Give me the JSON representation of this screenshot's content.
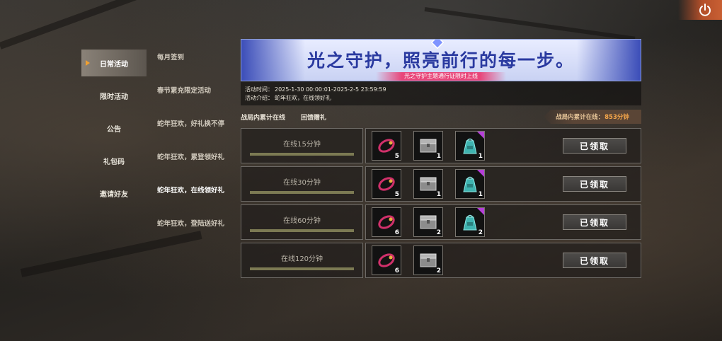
{
  "left_nav": [
    {
      "label": "日常活动",
      "active": true
    },
    {
      "label": "限时活动",
      "active": false
    },
    {
      "label": "公告",
      "active": false
    },
    {
      "label": "礼包码",
      "active": false
    },
    {
      "label": "邀请好友",
      "active": false
    }
  ],
  "sub_list": [
    {
      "label": "每月签到",
      "active": false
    },
    {
      "label": "春节累充限定活动",
      "active": false
    },
    {
      "label": "蛇年狂欢，好礼换不停",
      "active": false
    },
    {
      "label": "蛇年狂欢，累登领好礼",
      "active": false
    },
    {
      "label": "蛇年狂欢，在线领好礼",
      "active": true
    },
    {
      "label": "蛇年狂欢，登陆送好礼",
      "active": false
    }
  ],
  "banner": {
    "title": "光之守护，照亮前行的每一步。",
    "subtitle": "光之守护主题通行证限时上线"
  },
  "info": {
    "time_label": "活动时间：",
    "time_value": "2025-1-30 00:00:01-2025-2-5 23:59:59",
    "desc_label": "活动介绍：",
    "desc_value": "蛇年狂欢，在线领好礼"
  },
  "list_header": {
    "col1": "战局内累计在线",
    "col2": "回馈赠礼",
    "total_label": "战局内累计在线：",
    "total_value": "853分钟"
  },
  "rows": [
    {
      "time": "在线15分钟",
      "progress": 1.0,
      "items": [
        {
          "icon": "bracelet-icon",
          "count": "5",
          "purple": false
        },
        {
          "icon": "crate-icon",
          "count": "1",
          "purple": false
        },
        {
          "icon": "bag-icon",
          "count": "1",
          "purple": true
        }
      ],
      "button": "已领取"
    },
    {
      "time": "在线30分钟",
      "progress": 1.0,
      "items": [
        {
          "icon": "bracelet-icon",
          "count": "5",
          "purple": false
        },
        {
          "icon": "crate-icon",
          "count": "1",
          "purple": false
        },
        {
          "icon": "bag-icon",
          "count": "1",
          "purple": true
        }
      ],
      "button": "已领取"
    },
    {
      "time": "在线60分钟",
      "progress": 1.0,
      "items": [
        {
          "icon": "bracelet-icon",
          "count": "6",
          "purple": false
        },
        {
          "icon": "crate-icon",
          "count": "2",
          "purple": false
        },
        {
          "icon": "bag-icon",
          "count": "2",
          "purple": true
        }
      ],
      "button": "已领取"
    },
    {
      "time": "在线120分钟",
      "progress": 1.0,
      "items": [
        {
          "icon": "bracelet-icon",
          "count": "6",
          "purple": false
        },
        {
          "icon": "crate-icon",
          "count": "2",
          "purple": false
        }
      ],
      "button": "已领取"
    }
  ],
  "colors": {
    "accent": "#f0a030",
    "total_value": "#f5a64a",
    "banner_text": "#2a3aa0",
    "purple_tag": "#b540d8"
  }
}
